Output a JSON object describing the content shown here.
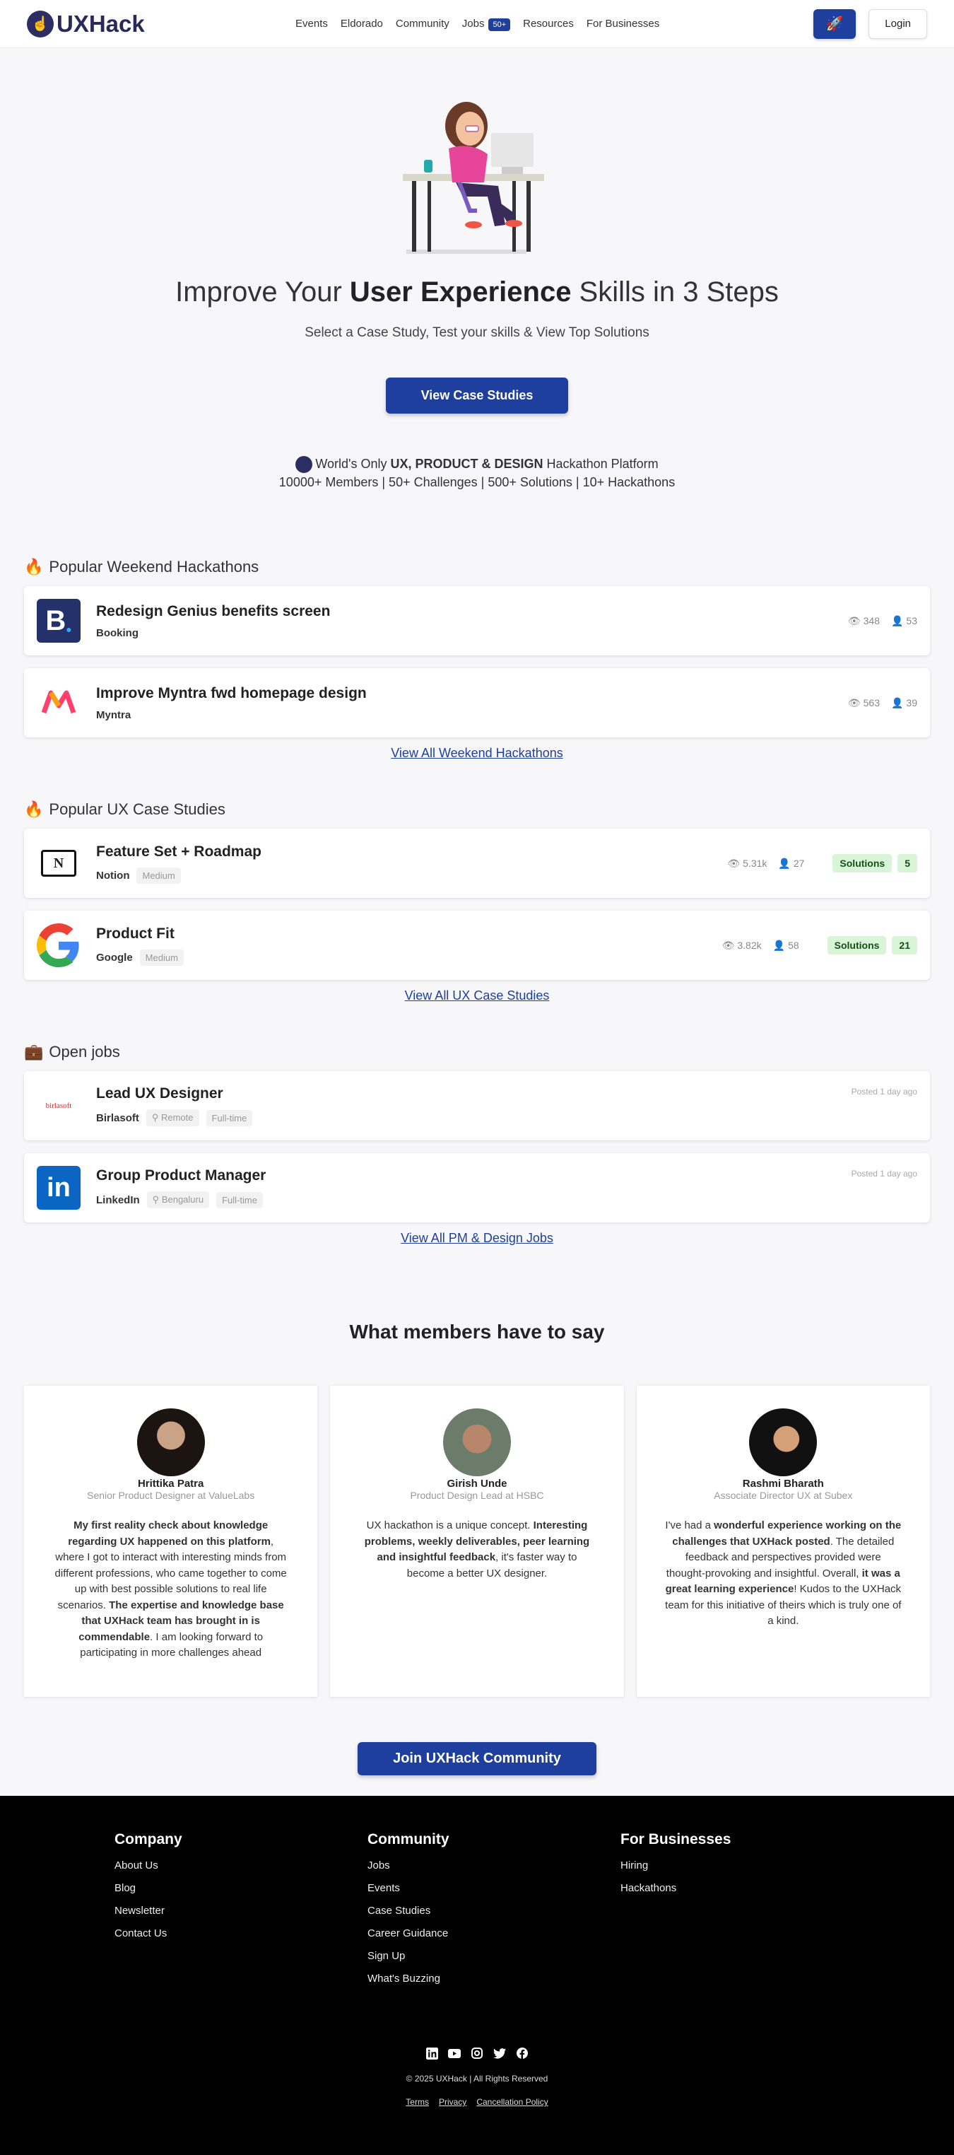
{
  "nav": {
    "brand": "UXHack",
    "links": [
      "Events",
      "Eldorado",
      "Community",
      "Jobs",
      "Resources",
      "For Businesses"
    ],
    "jobs_badge": "50+",
    "login": "Login"
  },
  "hero": {
    "title_pre": "Improve Your ",
    "title_bold": "User Experience",
    "title_post": " Skills in 3 Steps",
    "subtitle": "Select a Case Study, Test your skills & View Top Solutions",
    "cta": "View Case Studies",
    "platform_pre": "World's Only ",
    "platform_bold": "UX, PRODUCT & DESIGN",
    "platform_post": " Hackathon Platform",
    "stats_line": "10000+ Members | 50+ Challenges | 500+ Solutions | 10+ Hackathons"
  },
  "hackathons": {
    "heading": "Popular Weekend Hackathons",
    "items": [
      {
        "title": "Redesign Genius benefits screen",
        "company": "Booking",
        "views": "348",
        "members": "53"
      },
      {
        "title": "Improve Myntra fwd homepage design",
        "company": "Myntra",
        "views": "563",
        "members": "39"
      }
    ],
    "view_all": "View All Weekend Hackathons"
  },
  "case_studies": {
    "heading": "Popular UX Case Studies",
    "items": [
      {
        "title": "Feature Set + Roadmap",
        "company": "Notion",
        "level": "Medium",
        "views": "5.31k",
        "members": "27",
        "solutions_label": "Solutions",
        "solutions": "5"
      },
      {
        "title": "Product Fit",
        "company": "Google",
        "level": "Medium",
        "views": "3.82k",
        "members": "58",
        "solutions_label": "Solutions",
        "solutions": "21"
      }
    ],
    "view_all": "View All UX Case Studies"
  },
  "jobs": {
    "heading": "Open jobs",
    "items": [
      {
        "title": "Lead UX Designer",
        "company": "Birlasoft",
        "location": "Remote",
        "type": "Full-time",
        "posted": "Posted 1 day ago"
      },
      {
        "title": "Group Product Manager",
        "company": "LinkedIn",
        "location": "Bengaluru",
        "type": "Full-time",
        "posted": "Posted 1 day ago"
      }
    ],
    "view_all": "View All PM & Design Jobs"
  },
  "testimonials": {
    "heading": "What members have to say",
    "items": [
      {
        "name": "Hrittika Patra",
        "role": "Senior Product Designer at ValueLabs"
      },
      {
        "name": "Girish Unde",
        "role": "Product Design Lead at HSBC"
      },
      {
        "name": "Rashmi Bharath",
        "role": "Associate Director UX at Subex"
      }
    ],
    "q1": {
      "a": "My first reality check about knowledge regarding UX happened on this platform",
      "b": ", where I got to interact with interesting minds from different professions, who came together to come up with best possible solutions to real life scenarios. ",
      "c": "The expertise and knowledge base that UXHack team has brought in is commendable",
      "d": ". I am looking forward to participating in more challenges ahead"
    },
    "q2": {
      "a": "UX hackathon is a unique concept. ",
      "b": "Interesting problems, weekly deliverables, peer learning and insightful feedback",
      "c": ", it's faster way to become a better UX designer."
    },
    "q3": {
      "a": "I've had a ",
      "b": "wonderful experience working on the challenges that UXHack posted",
      "c": ". The detailed feedback and perspectives provided were thought-provoking and insightful. Overall, ",
      "d": "it was a great learning experience",
      "e": "! Kudos to the UXHack team for this initiative of theirs which is truly one of a kind."
    },
    "join": "Join UXHack Community"
  },
  "footer": {
    "company": {
      "heading": "Company",
      "links": [
        "About Us",
        "Blog",
        "Newsletter",
        "Contact Us"
      ]
    },
    "community": {
      "heading": "Community",
      "links": [
        "Jobs",
        "Events",
        "Case Studies",
        "Career Guidance",
        "Sign Up",
        "What's Buzzing"
      ]
    },
    "business": {
      "heading": "For Businesses",
      "links": [
        "Hiring",
        "Hackathons"
      ]
    },
    "copyright": "© 2025 UXHack | All Rights Reserved",
    "legal": [
      "Terms",
      "Privacy",
      "Cancellation Policy"
    ]
  },
  "colors": {
    "primary": "#1e3f9e",
    "brand": "#2b2d63",
    "footer": "#000000"
  }
}
